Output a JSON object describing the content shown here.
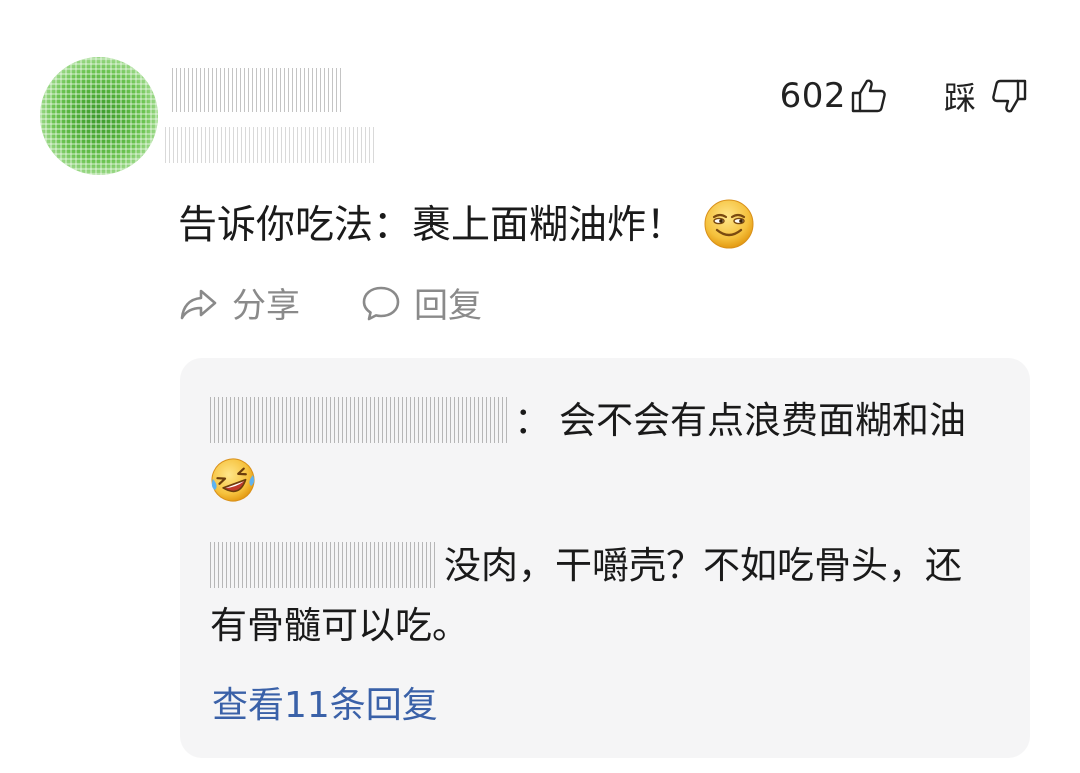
{
  "comment": {
    "like_count": "602",
    "dislike_label": "踩",
    "text": "告诉你吃法：裹上面糊油炸！",
    "emoji": "smirk-emoji",
    "actions": {
      "share_label": "分享",
      "reply_label": "回复"
    }
  },
  "replies": [
    {
      "separator": "：",
      "text": "会不会有点浪费面糊和油",
      "emoji": "laugh-cry-emoji"
    },
    {
      "text": "没肉，干嚼壳？不如吃骨头，还有骨髓可以吃。"
    }
  ],
  "view_more_label": "查看11条回复",
  "colors": {
    "link_blue": "#3a61a8",
    "muted_gray": "#8a8a8a",
    "reply_bg": "#f5f5f6"
  }
}
